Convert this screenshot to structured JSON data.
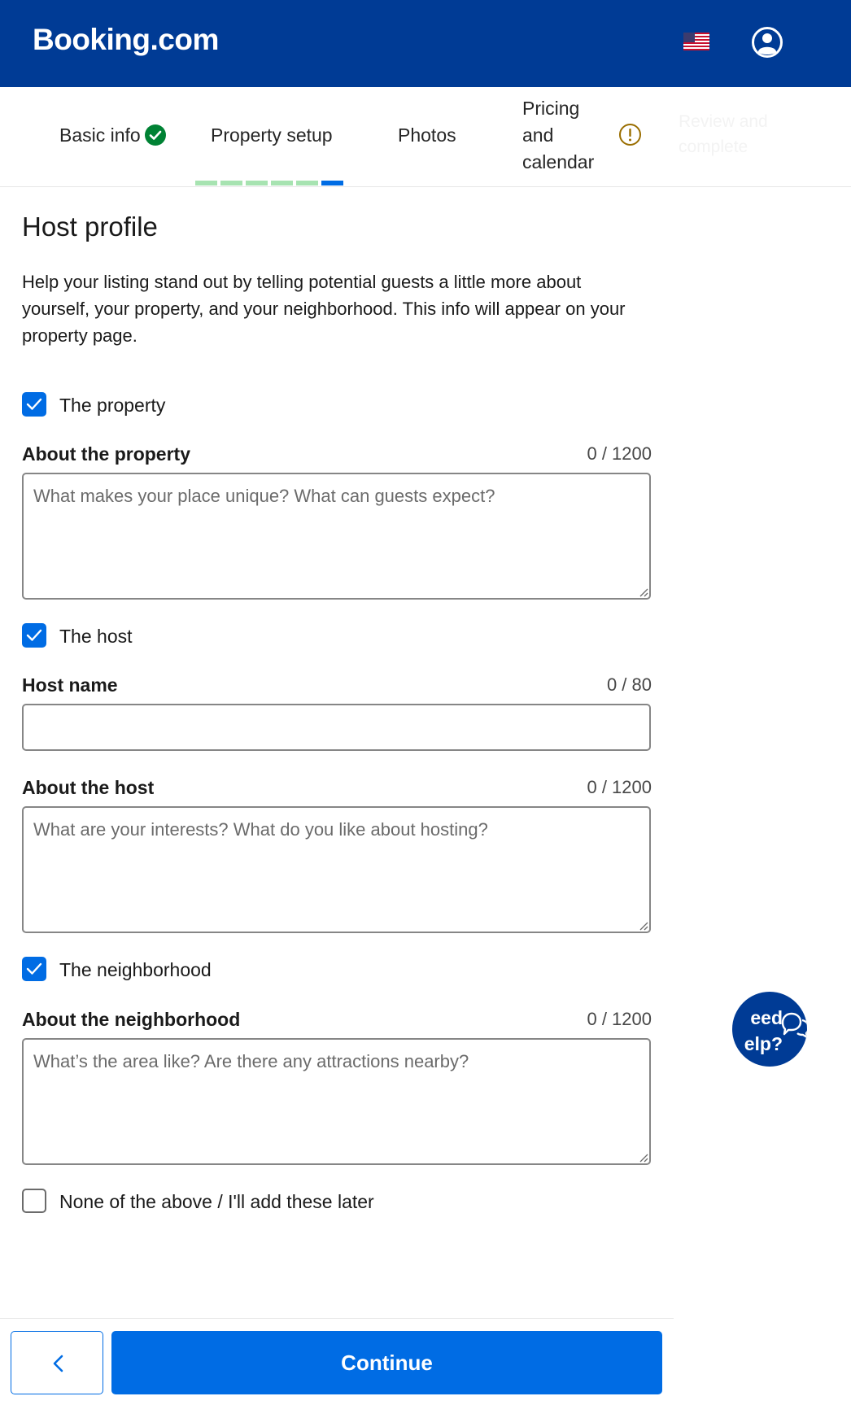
{
  "header": {
    "logo": "Booking.com",
    "flag_icon": "us-flag-icon",
    "account_icon": "account-icon",
    "colors": {
      "brand": "#003b95"
    }
  },
  "stepper": {
    "steps": [
      {
        "label": "Basic info",
        "status": "complete"
      },
      {
        "label": "Property setup",
        "status": "current"
      },
      {
        "label": "Photos",
        "status": "upcoming"
      },
      {
        "label": "Pricing and calendar",
        "status": "warning"
      },
      {
        "label": "Review and complete",
        "status": "disabled"
      }
    ],
    "progress": {
      "total_segments": 6,
      "completed_segments": 5,
      "current_segment": 6
    },
    "colors": {
      "complete": "#008234",
      "warning": "#9a6e00",
      "progress_done": "#a7e3b1",
      "progress_current": "#006ce4"
    }
  },
  "content": {
    "title": "Host profile",
    "intro": "Help your listing stand out by telling potential guests a little more about yourself, your property, and your neighborhood. This info will appear on your property page.",
    "property": {
      "checkbox_label": "The property",
      "checked": true,
      "field_label": "About the property",
      "counter": "0 / 1200",
      "value": "",
      "placeholder": "What makes your place unique? What can guests expect?"
    },
    "host": {
      "checkbox_label": "The host",
      "checked": true,
      "name_label": "Host name",
      "name_counter": "0 / 80",
      "name_value": "",
      "about_label": "About the host",
      "about_counter": "0 / 1200",
      "about_value": "",
      "about_placeholder": "What are your interests? What do you like about hosting?"
    },
    "neighborhood": {
      "checkbox_label": "The neighborhood",
      "checked": true,
      "field_label": "About the neighborhood",
      "counter": "0 / 1200",
      "value": "",
      "placeholder": "What’s the area like? Are there any attractions nearby?"
    },
    "none": {
      "checkbox_label": "None of the above / I'll add these later",
      "checked": false
    }
  },
  "help": {
    "text": "eed\nelp?",
    "icon": "chat-bubbles-icon"
  },
  "footer": {
    "back_icon": "chevron-left-icon",
    "continue_label": "Continue",
    "colors": {
      "primary": "#006ce4"
    }
  }
}
